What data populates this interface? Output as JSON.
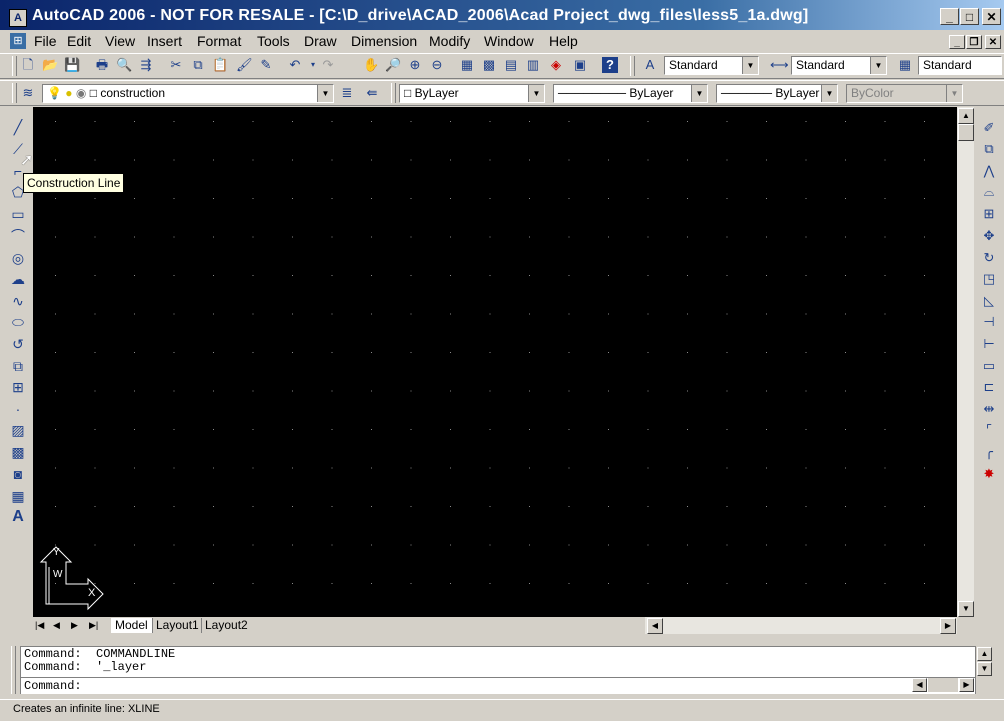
{
  "window": {
    "title": "AutoCAD 2006 - NOT FOR RESALE - [C:\\D_drive\\ACAD_2006\\Acad Project_dwg_files\\less5_1a.dwg]",
    "app_icon_label": "A",
    "caption_buttons": {
      "minimize": "_",
      "maximize": "□",
      "close": "✕"
    }
  },
  "menubar": {
    "items": [
      "File",
      "Edit",
      "View",
      "Insert",
      "Format",
      "Tools",
      "Draw",
      "Dimension",
      "Modify",
      "Window",
      "Help"
    ],
    "doc_buttons": {
      "minimize": "_",
      "restore": "❐",
      "close": "✕"
    }
  },
  "standard_toolbar": {
    "text_style": "Standard",
    "dim_style": "Standard",
    "table_style": "Standard"
  },
  "layers_toolbar": {
    "current_layer": "construction",
    "color": "ByLayer",
    "linetype": "ByLayer",
    "lineweight": "ByLayer",
    "plot_style": "ByColor"
  },
  "tooltip": {
    "text": "Construction Line"
  },
  "layout_tabs": {
    "nav_buttons": [
      "|◀",
      "◀",
      "▶",
      "▶|"
    ],
    "tabs": [
      "Model",
      "Layout1",
      "Layout2"
    ],
    "active": "Model"
  },
  "ucs_icon": {
    "x_label": "X",
    "y_label": "Y",
    "w_label": "W"
  },
  "command_window": {
    "history": [
      "Command:  COMMANDLINE",
      "Command:  '_layer"
    ],
    "prompt": "Command:"
  },
  "status_bar": {
    "text": "Creates an infinite line:  XLINE"
  },
  "colors": {
    "titlebar_start": "#0a246a",
    "canvas": "#000000",
    "chrome": "#d4d0c8",
    "tooltip_bg": "#ffffe1"
  }
}
